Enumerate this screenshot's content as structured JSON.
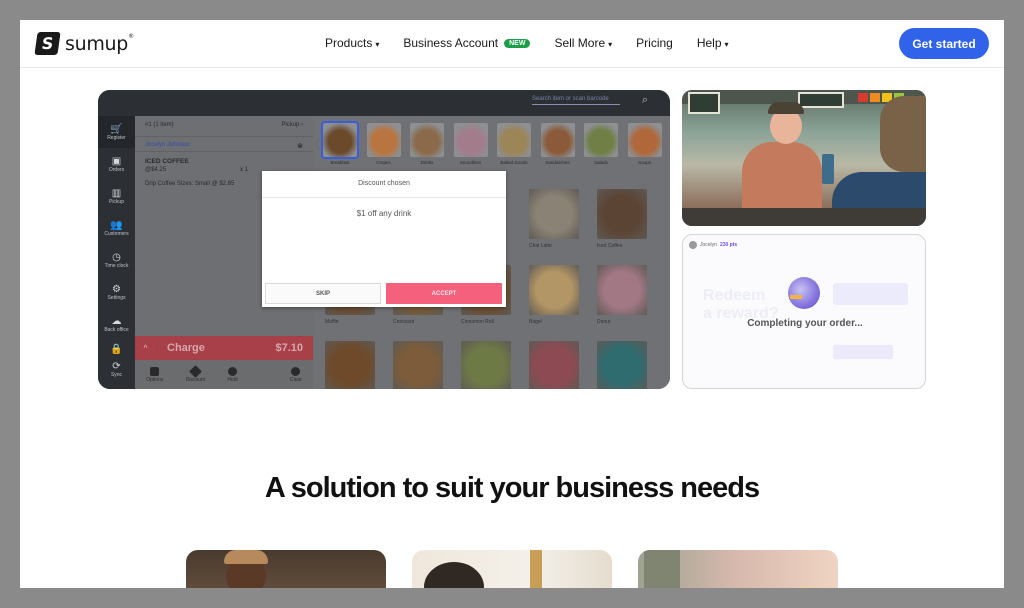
{
  "brand": {
    "name": "sumup",
    "reg": "®",
    "logo_glyph": "S"
  },
  "nav": {
    "items": [
      {
        "label": "Products",
        "dropdown": true
      },
      {
        "label": "Business Account",
        "badge": "NEW"
      },
      {
        "label": "Sell More",
        "dropdown": true
      },
      {
        "label": "Pricing"
      },
      {
        "label": "Help",
        "dropdown": true
      }
    ],
    "cta": "Get started",
    "chevron": "⌄"
  },
  "pos": {
    "search_placeholder": "Search item or scan barcode",
    "search_icon": "⌕",
    "sidebar": [
      {
        "label": "Register",
        "icon": "cart-icon",
        "glyph": "🛒",
        "active": true
      },
      {
        "label": "Orders",
        "icon": "orders-icon",
        "glyph": "▣"
      },
      {
        "label": "Pickup",
        "icon": "pickup-icon",
        "glyph": "▥"
      },
      {
        "label": "Customers",
        "icon": "customers-icon",
        "glyph": "👥"
      },
      {
        "label": "Time clock",
        "icon": "clock-icon",
        "glyph": "◷"
      },
      {
        "label": "Settings",
        "icon": "gear-icon",
        "glyph": "⚙"
      },
      {
        "label": "Back office",
        "icon": "cloud-icon",
        "glyph": "☁"
      },
      {
        "label": "",
        "icon": "lock-icon",
        "glyph": "🔒"
      },
      {
        "label": "Sync",
        "icon": "sync-icon",
        "glyph": "⟳"
      }
    ],
    "order": {
      "header": "#1 (1 item)",
      "pickup": "Pickup",
      "customer": "Jocelyn Johnson",
      "item_name": "ICED COFFEE",
      "item_price": "@$4.25",
      "item_qty": "x 1",
      "modifier": "Drip Coffee Sizes: Small @ $2.85",
      "charge_label": "Charge",
      "charge_total": "$7.10",
      "actions": [
        "Options",
        "Discount",
        "Hold",
        "Clear"
      ]
    },
    "categories": [
      "Breakfast",
      "Crepes",
      "Drinks",
      "Smoothies",
      "Baked Goods",
      "Sandwiches",
      "Salads",
      "Soups"
    ],
    "products": [
      "Chai Latte",
      "Iced Coffee",
      "Muffin",
      "Croissant",
      "Cinnamon Roll",
      "Bagel",
      "Donut"
    ],
    "modal": {
      "title": "Discount chosen",
      "body": "$1 off any drink",
      "skip": "SKIP",
      "accept": "ACCEPT"
    }
  },
  "reward": {
    "user": "Jocelyn",
    "points": "230 pts",
    "heading_line1": "Redeem",
    "heading_line2": "a reward?",
    "status": "Completing your order..."
  },
  "headline": "A solution to suit your business needs",
  "colors": {
    "cta": "#3063e9",
    "new_badge": "#1a9e47",
    "accept": "#f5617c",
    "charge": "#a8404a"
  }
}
